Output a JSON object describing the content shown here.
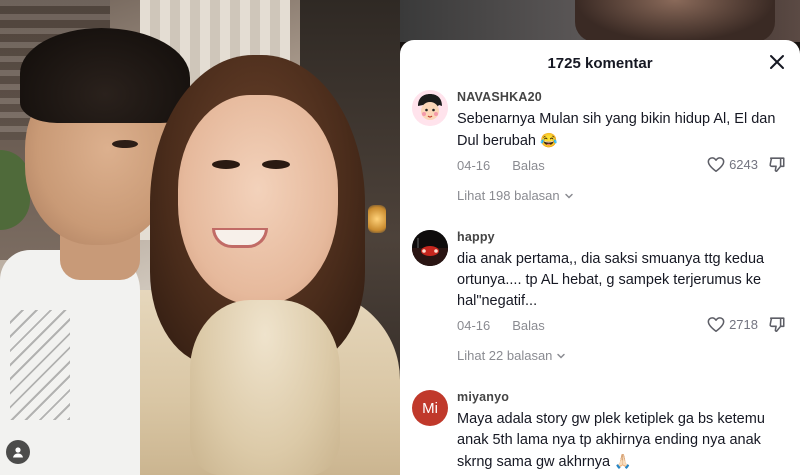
{
  "sheet": {
    "title": "1725 komentar"
  },
  "comments": [
    {
      "username": "NAVASHKA20",
      "text": "Sebenarnya Mulan sih yang bikin hidup Al, El dan Dul berubah",
      "emoji": "😂",
      "date": "04-16",
      "reply_label": "Balas",
      "likes": "6243",
      "view_replies": "Lihat 198 balasan"
    },
    {
      "username": "happy",
      "text": "dia anak pertama,, dia saksi smuanya ttg kedua ortunya.... tp AL hebat, g sampek terjerumus ke hal\"negatif...",
      "emoji": "",
      "date": "04-16",
      "reply_label": "Balas",
      "likes": "2718",
      "view_replies": "Lihat 22 balasan"
    },
    {
      "username": "miyanyo",
      "avatar_initials": "Mi",
      "text": "Maya adala story gw plek ketiplek ga bs ketemu anak 5th lama nya tp akhirnya ending nya anak skrng sama gw akhrnya",
      "emoji": "🙏🏻"
    }
  ],
  "colors": {
    "accent_avatar": "#c0392b",
    "text_primary": "#161823",
    "text_secondary": "#8a8b91"
  },
  "icons": [
    "close-icon",
    "heart-icon",
    "dislike-icon",
    "chevron-down-icon",
    "user-icon"
  ]
}
